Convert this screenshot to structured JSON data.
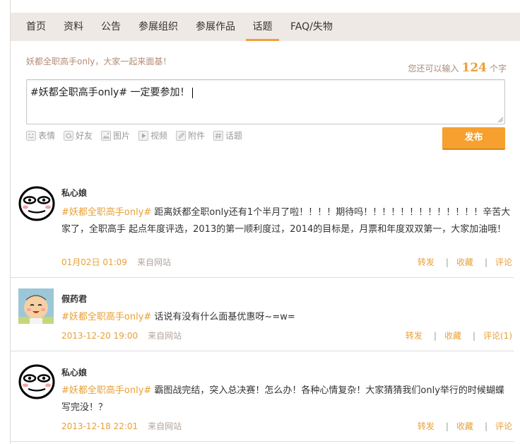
{
  "nav": {
    "items": [
      "首页",
      "资料",
      "公告",
      "参展组织",
      "参展作品",
      "话题",
      "FAQ/失物"
    ],
    "active_index": 5
  },
  "composer": {
    "hint": "妖都全职高手only，大家一起来面基！",
    "counter_prefix": "您还可以输入",
    "counter_value": "124",
    "counter_suffix": "个字",
    "text": "#妖都全职高手only# 一定要参加！",
    "tools": [
      "表情",
      "好友",
      "图片",
      "视频",
      "附件",
      "话题"
    ],
    "publish_label": "发布"
  },
  "posts": [
    {
      "user": "私心娘",
      "avatar": "troll-face-avatar",
      "tag": "#妖都全职高手only#",
      "text": " 距离妖都全职only还有1个半月了啦！！！！期待吗！！！！！！！！！！！！！辛苦大家了，全职高手 起点年度评选，2013的第一顺利度过，2014的目标是，月票和年度双双第一，大家加油哦！",
      "time": "01月02日 01:09",
      "source": "来自网站",
      "repost": "转发",
      "favorite": "收藏",
      "comment": "评论"
    },
    {
      "user": "假药君",
      "avatar": "cartoon-boy-avatar",
      "tag": "#妖都全职高手only#",
      "text": " 话说有没有什么面基优惠呀~=w=",
      "time": "2013-12-20 19:00",
      "source": "来自网站",
      "repost": "转发",
      "favorite": "收藏",
      "comment": "评论(1)"
    },
    {
      "user": "私心娘",
      "avatar": "troll-face-avatar",
      "tag": "#妖都全职高手only#",
      "text": " 霸图战完结，突入总决赛！怎么办！各种心情复杂！大家猜猜我们only举行的时候蝴蝶写完没！？",
      "time": "2013-12-18 22:01",
      "source": "来自网站",
      "repost": "转发",
      "favorite": "收藏",
      "comment": "评论"
    }
  ]
}
